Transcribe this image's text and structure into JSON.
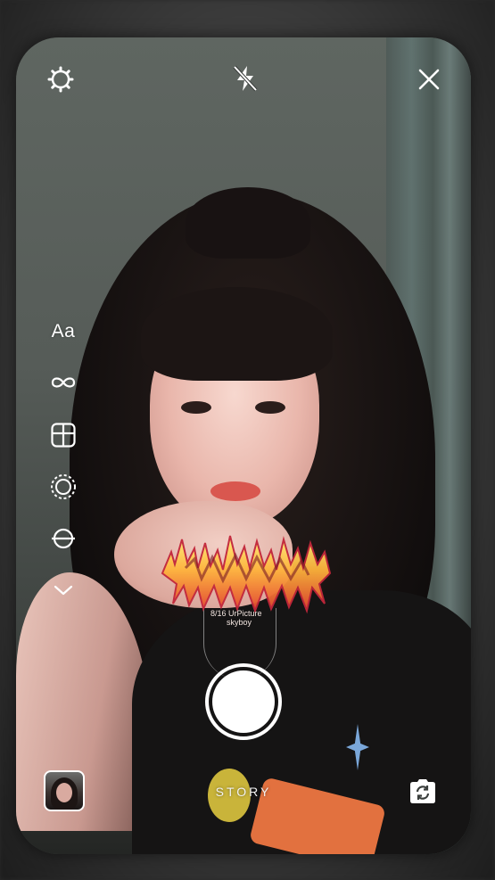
{
  "top_bar": {
    "settings_icon": "gear-icon",
    "flash_icon": "flash-off-icon",
    "close_icon": "close-icon"
  },
  "side_tools": {
    "text_tool_label": "Aa",
    "items": [
      {
        "icon": "text-tool-icon"
      },
      {
        "icon": "boomerang-infinity-icon"
      },
      {
        "icon": "layout-icon"
      },
      {
        "icon": "hands-free-icon"
      },
      {
        "icon": "level-icon"
      },
      {
        "icon": "chevron-down-icon"
      }
    ]
  },
  "sticker": {
    "subtitle_line1": "8/16 UrPicture",
    "subtitle_line2": "skyboy"
  },
  "bottom_bar": {
    "mode_label": "STORY",
    "gallery_icon": "gallery-thumbnail",
    "flip_icon": "flip-camera-icon",
    "shutter_icon": "shutter-button"
  }
}
